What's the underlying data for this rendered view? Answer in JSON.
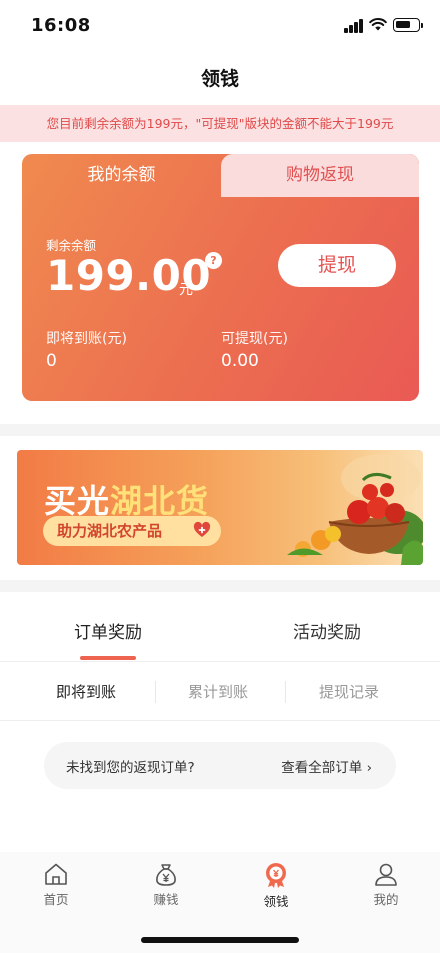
{
  "status_bar": {
    "time": "16:08"
  },
  "header": {
    "title": "领钱"
  },
  "notice": {
    "text": "您目前剩余余额为199元，\"可提现\"版块的金额不能大于199元"
  },
  "balance_card": {
    "tabs": [
      {
        "label": "我的余额",
        "active": true
      },
      {
        "label": "购物返现",
        "active": false
      }
    ],
    "remaining_label": "剩余余额",
    "amount": "199.00",
    "unit": "元",
    "help_symbol": "?",
    "withdraw_button": "提现",
    "pending_label": "即将到账(元)",
    "pending_value": "0",
    "withdrawable_label": "可提现(元)",
    "withdrawable_value": "0.00"
  },
  "banner": {
    "headline_prefix": "买光",
    "headline_highlight": "湖北货",
    "tagline": "助力湖北农产品"
  },
  "reward_tabs": [
    {
      "label": "订单奖励",
      "active": true
    },
    {
      "label": "活动奖励",
      "active": false
    }
  ],
  "sub_tabs": [
    {
      "label": "即将到账",
      "active": true
    },
    {
      "label": "累计到账",
      "active": false
    },
    {
      "label": "提现记录",
      "active": false
    }
  ],
  "order_prompt": {
    "question": "未找到您的返现订单?",
    "link": "查看全部订单",
    "chevron": "›"
  },
  "bottom_nav": [
    {
      "label": "首页",
      "icon": "home-icon",
      "active": false
    },
    {
      "label": "赚钱",
      "icon": "money-bag-icon",
      "active": false
    },
    {
      "label": "领钱",
      "icon": "coin-medal-icon",
      "active": true
    },
    {
      "label": "我的",
      "icon": "user-icon",
      "active": false
    }
  ],
  "colors": {
    "accent": "#ec6e50",
    "notice_bg": "#fbe1e1",
    "notice_text": "#e04a4a",
    "tab_inactive_bg": "#fbdcdc"
  }
}
